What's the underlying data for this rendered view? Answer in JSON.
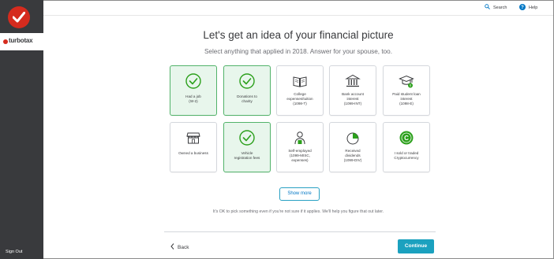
{
  "brand": {
    "name": "turbotax"
  },
  "sidebar": {
    "sign_out": "Sign Out"
  },
  "topbar": {
    "search": "Search",
    "help": "Help"
  },
  "main": {
    "title": "Let's get an idea of your financial picture",
    "subtitle": "Select anything that applied in 2018. Answer for your spouse, too.",
    "tiles": [
      {
        "label": "Had a job\n(W-2)",
        "selected": true,
        "icon": "check-icon"
      },
      {
        "label": "Donations to\ncharity",
        "selected": true,
        "icon": "check-icon"
      },
      {
        "label": "College\nexpenses/tuition\n(1098-T)",
        "selected": false,
        "icon": "books-icon"
      },
      {
        "label": "Bank account\ninterest\n(1099-INT)",
        "selected": false,
        "icon": "bank-icon"
      },
      {
        "label": "Paid student loan\ninterest\n(1098-E)",
        "selected": false,
        "icon": "graduation-cap-icon"
      },
      {
        "label": "Owned a business",
        "selected": false,
        "icon": "storefront-icon"
      },
      {
        "label": "Vehicle\nregistration fees",
        "selected": true,
        "icon": "check-icon"
      },
      {
        "label": "Self-employed\n(1099-MISC,\nexpenses)",
        "selected": false,
        "icon": "person-icon"
      },
      {
        "label": "Received\ndividends\n(1099-DIV)",
        "selected": false,
        "icon": "pie-chart-icon"
      },
      {
        "label": "I sold or traded\nCryptocurrency",
        "selected": false,
        "icon": "coin-icon"
      }
    ],
    "show_more": "Show more",
    "note": "It's OK to pick something even if you're not sure if it applies. We'll help you figure that out later."
  },
  "footer": {
    "back": "Back",
    "continue": "Continue"
  },
  "colors": {
    "accent": "#1ba1bf",
    "brand_red": "#d52b1e",
    "selected_bg": "#e8f6ec",
    "selected_border": "#52b36a",
    "sidebar": "#393a3d"
  }
}
